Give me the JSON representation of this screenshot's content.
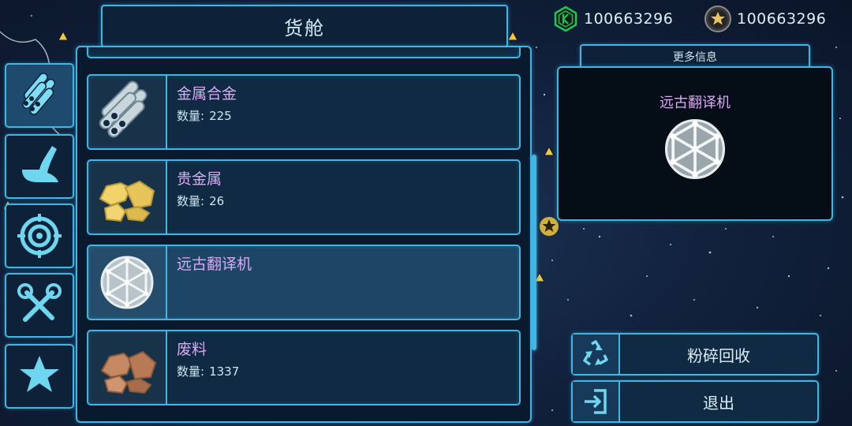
{
  "title": "货舱",
  "currency": [
    {
      "icon": "credit-icon",
      "value": "100663296"
    },
    {
      "icon": "star-coin-icon",
      "value": "100663296"
    }
  ],
  "tabs": [
    {
      "icon": "materials-icon",
      "active": true
    },
    {
      "icon": "ship-part-icon",
      "active": false
    },
    {
      "icon": "target-icon",
      "active": false
    },
    {
      "icon": "tools-icon",
      "active": false
    },
    {
      "icon": "star-icon",
      "active": false
    }
  ],
  "cargo_items": [
    {
      "name": "金属合金",
      "qty_label": "数量:",
      "qty": "225",
      "icon": "metal-alloy-icon"
    },
    {
      "name": "贵金属",
      "qty_label": "数量:",
      "qty": "26",
      "icon": "precious-metal-icon"
    },
    {
      "name": "远古翻译机",
      "qty_label": "",
      "qty": "",
      "icon": "ancient-translator-icon"
    },
    {
      "name": "废料",
      "qty_label": "数量:",
      "qty": "1337",
      "icon": "scrap-icon"
    }
  ],
  "detail": {
    "header": "更多信息",
    "name": "远古翻译机",
    "icon": "ancient-translator-icon"
  },
  "actions": [
    {
      "label": "粉碎回收",
      "icon": "recycle-icon"
    },
    {
      "label": "退出",
      "icon": "exit-icon"
    }
  ],
  "colors": {
    "accent": "#3fb6e3",
    "item_name": "#d9a9f2",
    "panel_bg": "#0d2238",
    "selected_bg": "#1d4565",
    "credit_green": "#22c25a",
    "coin_gold": "#e8c560"
  }
}
